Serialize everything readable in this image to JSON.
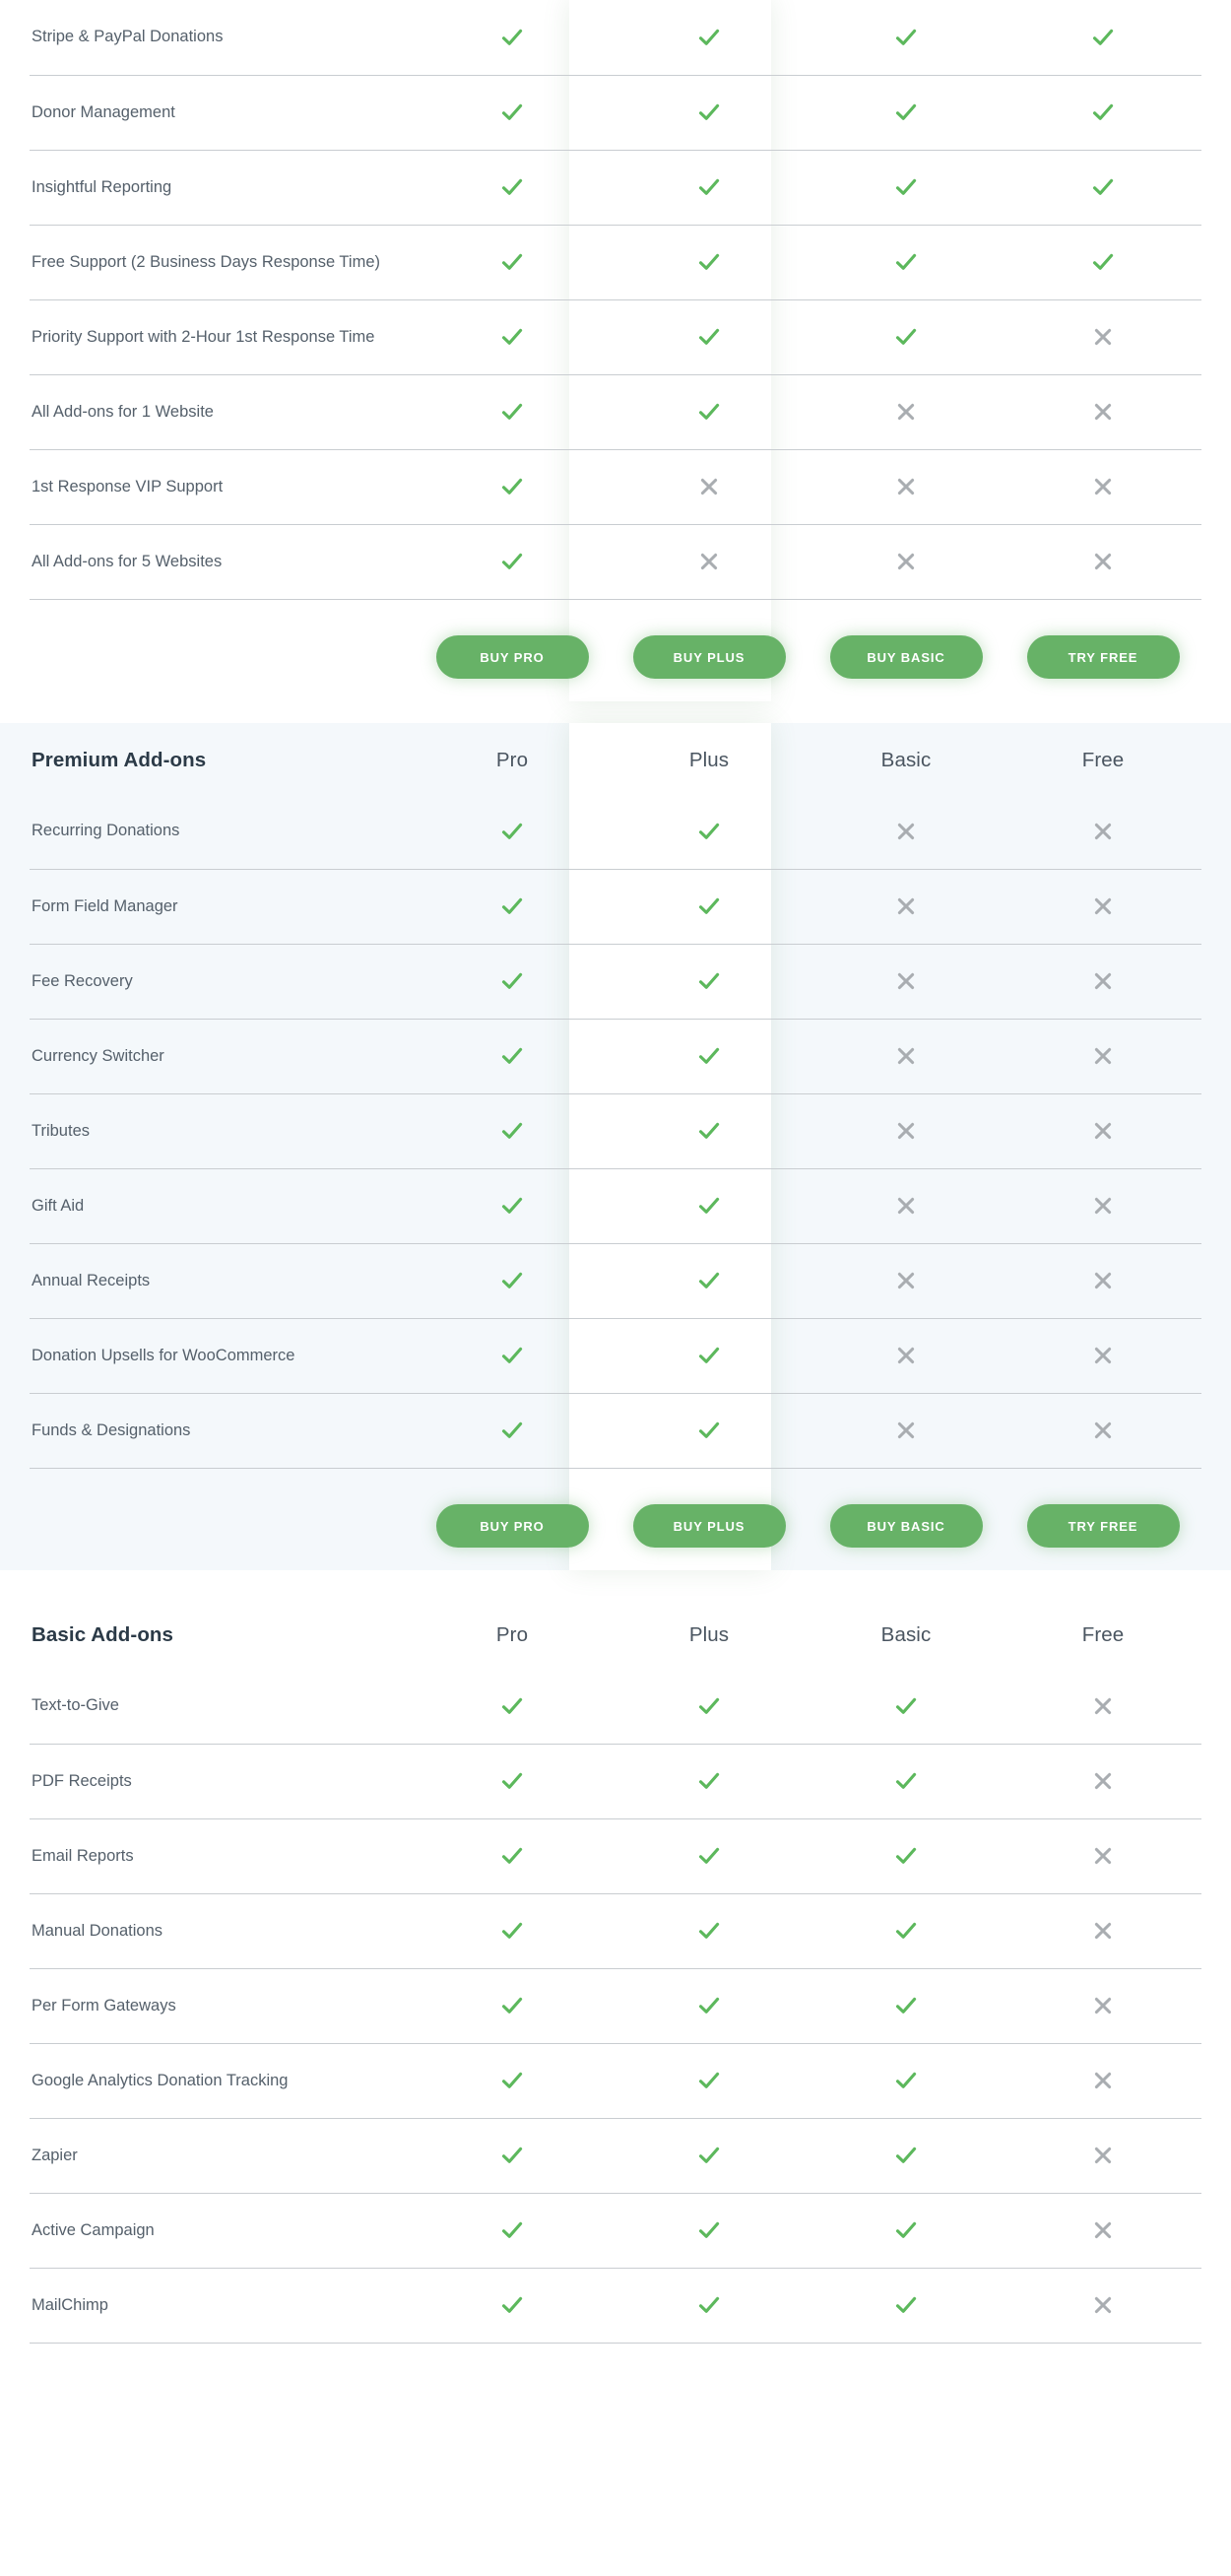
{
  "columns": [
    "Pro",
    "Plus",
    "Basic",
    "Free"
  ],
  "icons": {
    "check": "check-icon",
    "cross": "cross-icon"
  },
  "colors": {
    "check_green": "#5cb85c",
    "cross_gray": "#a9adb1",
    "button_green": "#67b267",
    "tint_background": "#f4f8fb",
    "row_border": "#c9cdd1",
    "feature_text": "#55606b",
    "heading_text": "#2b3a47"
  },
  "buttons": [
    {
      "label": "BUY PRO",
      "name": "buy-pro-button"
    },
    {
      "label": "BUY PLUS",
      "name": "buy-plus-button"
    },
    {
      "label": "BUY BASIC",
      "name": "buy-basic-button"
    },
    {
      "label": "TRY FREE",
      "name": "try-free-button"
    }
  ],
  "sections": [
    {
      "id": "core-features",
      "title": "",
      "show_header": false,
      "tinted": false,
      "highlight_plus": true,
      "rows": [
        {
          "feature": "Stripe & PayPal Donations",
          "values": [
            "check",
            "check",
            "check",
            "check"
          ]
        },
        {
          "feature": "Donor Management",
          "values": [
            "check",
            "check",
            "check",
            "check"
          ]
        },
        {
          "feature": "Insightful Reporting",
          "values": [
            "check",
            "check",
            "check",
            "check"
          ]
        },
        {
          "feature": "Free Support (2 Business Days Response Time)",
          "values": [
            "check",
            "check",
            "check",
            "check"
          ]
        },
        {
          "feature": "Priority Support with 2-Hour 1st Response Time",
          "values": [
            "check",
            "check",
            "check",
            "cross"
          ]
        },
        {
          "feature": "All Add-ons for 1 Website",
          "values": [
            "check",
            "check",
            "cross",
            "cross"
          ]
        },
        {
          "feature": "1st Response VIP Support",
          "values": [
            "check",
            "cross",
            "cross",
            "cross"
          ]
        },
        {
          "feature": "All Add-ons for 5 Websites",
          "values": [
            "check",
            "cross",
            "cross",
            "cross"
          ]
        }
      ]
    },
    {
      "id": "premium-add-ons",
      "title": "Premium Add-ons",
      "show_header": true,
      "tinted": true,
      "highlight_plus": true,
      "rows": [
        {
          "feature": "Recurring Donations",
          "values": [
            "check",
            "check",
            "cross",
            "cross"
          ]
        },
        {
          "feature": "Form Field Manager",
          "values": [
            "check",
            "check",
            "cross",
            "cross"
          ]
        },
        {
          "feature": "Fee Recovery",
          "values": [
            "check",
            "check",
            "cross",
            "cross"
          ]
        },
        {
          "feature": "Currency Switcher",
          "values": [
            "check",
            "check",
            "cross",
            "cross"
          ]
        },
        {
          "feature": "Tributes",
          "values": [
            "check",
            "check",
            "cross",
            "cross"
          ]
        },
        {
          "feature": "Gift Aid",
          "values": [
            "check",
            "check",
            "cross",
            "cross"
          ]
        },
        {
          "feature": "Annual Receipts",
          "values": [
            "check",
            "check",
            "cross",
            "cross"
          ]
        },
        {
          "feature": "Donation Upsells for WooCommerce",
          "values": [
            "check",
            "check",
            "cross",
            "cross"
          ]
        },
        {
          "feature": "Funds & Designations",
          "values": [
            "check",
            "check",
            "cross",
            "cross"
          ]
        }
      ]
    },
    {
      "id": "basic-add-ons",
      "title": "Basic Add-ons",
      "show_header": true,
      "tinted": false,
      "highlight_plus": false,
      "rows": [
        {
          "feature": "Text-to-Give",
          "values": [
            "check",
            "check",
            "check",
            "cross"
          ]
        },
        {
          "feature": "PDF Receipts",
          "values": [
            "check",
            "check",
            "check",
            "cross"
          ]
        },
        {
          "feature": "Email Reports",
          "values": [
            "check",
            "check",
            "check",
            "cross"
          ]
        },
        {
          "feature": "Manual Donations",
          "values": [
            "check",
            "check",
            "check",
            "cross"
          ]
        },
        {
          "feature": "Per Form Gateways",
          "values": [
            "check",
            "check",
            "check",
            "cross"
          ]
        },
        {
          "feature": "Google Analytics Donation Tracking",
          "values": [
            "check",
            "check",
            "check",
            "cross"
          ]
        },
        {
          "feature": "Zapier",
          "values": [
            "check",
            "check",
            "check",
            "cross"
          ]
        },
        {
          "feature": "Active Campaign",
          "values": [
            "check",
            "check",
            "check",
            "cross"
          ]
        },
        {
          "feature": "MailChimp",
          "values": [
            "check",
            "check",
            "check",
            "cross"
          ]
        }
      ]
    }
  ]
}
